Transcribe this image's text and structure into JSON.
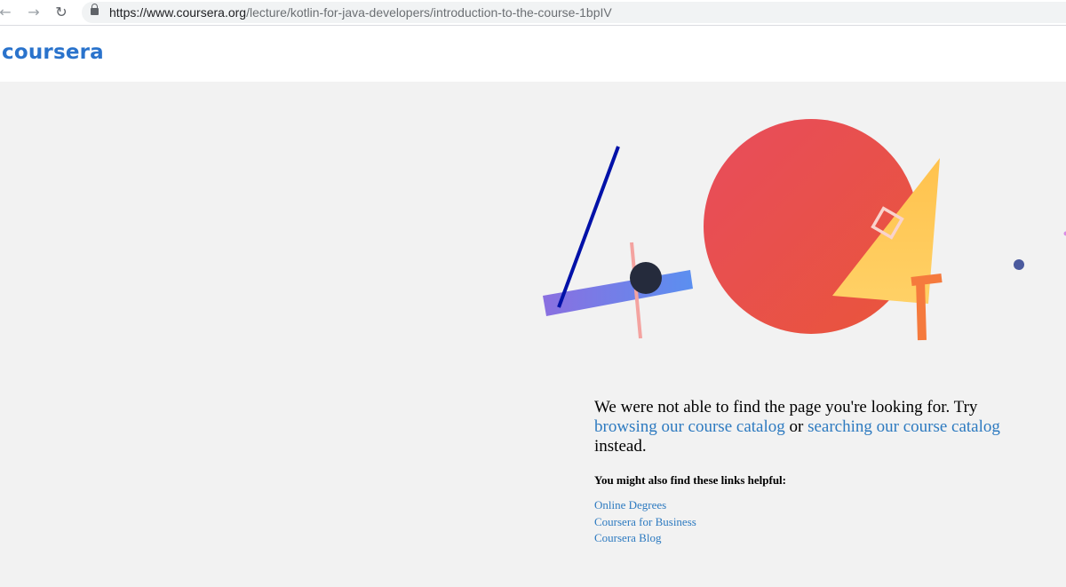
{
  "browser": {
    "url_host": "https://www.coursera.org",
    "url_path": "/lecture/kotlin-for-java-developers/introduction-to-the-course-1bpIV",
    "back_icon": "←",
    "forward_icon": "→",
    "reload_icon": "↻"
  },
  "header": {
    "logo_text": "coursera",
    "brand_color": "#2a73cc"
  },
  "illustration": {
    "description_icons": [
      "blue-line",
      "purple-bar",
      "pink-line",
      "dark-dot",
      "red-circle",
      "yellow-triangle",
      "white-square",
      "orange-bracket",
      "small-dot"
    ]
  },
  "message": {
    "text_before": "We were not able to find the page you're looking for. Try",
    "link_browse": "browsing our course catalog",
    "text_or": "or",
    "link_search": "searching our course catalog",
    "text_after": "instead."
  },
  "helpful": {
    "heading": "You might also find these links helpful:",
    "links": [
      "Online Degrees",
      "Coursera for Business",
      "Coursera Blog"
    ]
  },
  "colors": {
    "link": "#2d7ac0",
    "background": "#f2f2f2"
  }
}
